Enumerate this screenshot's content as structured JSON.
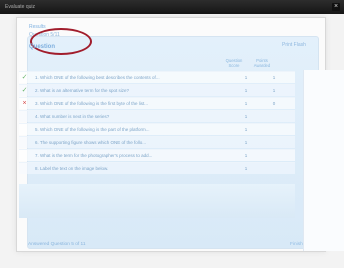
{
  "window": {
    "left_title": "Evaluate quiz",
    "close_symbol": "×"
  },
  "quiz": {
    "label_small": "Results",
    "label_sub": "Question 5/11",
    "question_header": "Question",
    "right_label": "Print Flash",
    "meta_headers": [
      "Question Score",
      "Points Awarded"
    ],
    "rows": [
      {
        "icon": "✓",
        "icon_name": "check-icon",
        "text": "1. Which ONE of the following best describes the contents of...",
        "num1": "1",
        "num2": "1"
      },
      {
        "icon": "✓",
        "icon_name": "check-icon",
        "text": "2. What is an alternative term for the spot size?",
        "num1": "1",
        "num2": "1"
      },
      {
        "icon": "×",
        "icon_name": "cross-icon",
        "text": "3. Which ONE of the following is the first byte of the list...",
        "num1": "1",
        "num2": "0"
      },
      {
        "icon": "",
        "icon_name": "blank-icon",
        "text": "4. What number is next in the series?",
        "num1": "1",
        "num2": ""
      },
      {
        "icon": "",
        "icon_name": "blank-icon",
        "text": "5. Which ONE of the following is the part of the platform...",
        "num1": "1",
        "num2": ""
      },
      {
        "icon": "",
        "icon_name": "blank-icon",
        "text": "6. The supporting figure shows which ONE of the follo...",
        "num1": "1",
        "num2": ""
      },
      {
        "icon": "",
        "icon_name": "blank-icon",
        "text": "7. What is the term for the photographer's process to add...",
        "num1": "1",
        "num2": ""
      },
      {
        "icon": "",
        "icon_name": "blank-icon",
        "text": "8. Label the text on the image below.",
        "num1": "1",
        "num2": ""
      }
    ],
    "footer_text": "Answered  Question 5 of 11",
    "footer_button": "Finish"
  },
  "colors": {
    "accent_blue": "#7fb0df",
    "circle_red": "#a11d2c",
    "correct_green": "#6ab66d",
    "wrong_red": "#d64c4c"
  }
}
